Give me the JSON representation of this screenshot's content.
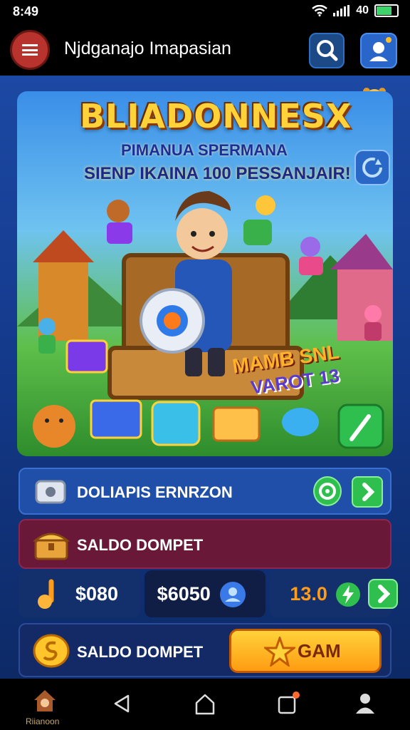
{
  "status_bar": {
    "time": "8:49",
    "network": "40"
  },
  "header": {
    "title": "Njdganajo Imapasian"
  },
  "banner": {
    "title": "BLIADONNESX",
    "subtitle_1": "PIMANUA SPERMANA",
    "subtitle_2": "SIENP IKAINA 100 PESSANJAIR!",
    "tag_1": "MAMB SNL",
    "tag_2": "VAROT 13"
  },
  "rows": {
    "row1_label": "DOLIAPIS ERNRZON",
    "row2_label": "SALDO DOMPET",
    "row3_label": "SALDO DOMPET"
  },
  "stats": {
    "value_1": "$080",
    "value_2": "$6050",
    "value_3": "13.0"
  },
  "action": {
    "claim_label": "GAM"
  },
  "bottom_nav": {
    "home_label": "Riianoon"
  },
  "colors": {
    "accent_yellow": "#ffc52a",
    "green": "#2fbf4f",
    "header_red": "#b8332d"
  }
}
